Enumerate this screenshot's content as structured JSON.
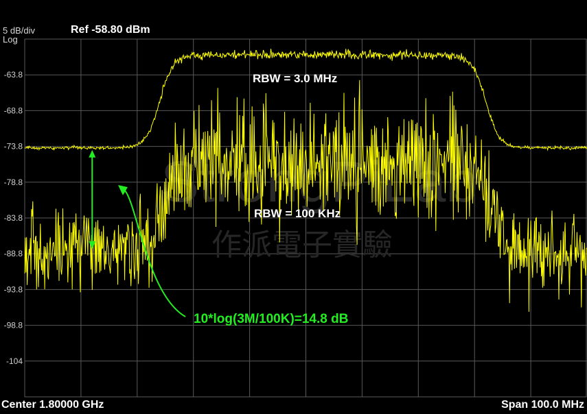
{
  "header": {
    "scale": "5 dB/div",
    "log": "Log",
    "ref": "Ref -58.80 dBm"
  },
  "footer": {
    "center": "Center 1.80000 GHz",
    "span": "Span 100.0 MHz"
  },
  "watermark": {
    "title": "StrongPiLab",
    "subtitle": "作派電子實驗"
  },
  "colors": {
    "trace": "#ffff00",
    "annotation": "#22ee22",
    "grid": "#5a5a5a",
    "text": "#ffffff"
  },
  "chart_data": {
    "type": "line",
    "y_unit": "dBm",
    "ylim": [
      -108.8,
      -58.8
    ],
    "y_ticks": [
      "-63.8",
      "-68.8",
      "-73.8",
      "-78.8",
      "-83.8",
      "-88.8",
      "-93.8",
      "-98.8",
      "-104"
    ],
    "xlim_mhz": [
      1750,
      1850
    ],
    "grid": true,
    "series": [
      {
        "label": "RBW = 3.0 MHz",
        "noise_floor": -74.0,
        "peak": -61.0,
        "edges_mhz": [
          1774,
          1832
        ],
        "ripple_db": 0.6
      },
      {
        "label": "RBW = 100 KHz",
        "noise_floor": -88.6,
        "peak": -76.0,
        "edges_mhz": [
          1775,
          1833
        ],
        "ripple_db": 4.5
      }
    ],
    "annotations": [
      {
        "text": "10*log(3M/100K)=14.8 dB",
        "x_mhz": 1762,
        "y_top": -74.0,
        "y_bottom": -88.6
      }
    ]
  }
}
